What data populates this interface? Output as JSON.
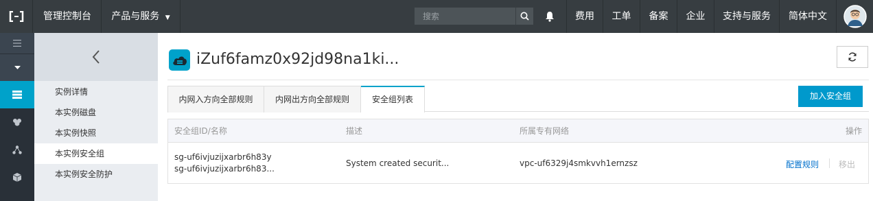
{
  "topbar": {
    "console_label": "管理控制台",
    "products_label": "产品与服务",
    "search_placeholder": "搜索",
    "nav": [
      "费用",
      "工单",
      "备案",
      "企业",
      "支持与服务",
      "简体中文"
    ]
  },
  "sidebar_icons": [
    "menu-icon",
    "chevron-down-icon",
    "server-list-icon",
    "cloud-icon",
    "network-icon",
    "cube-icon"
  ],
  "subnav": {
    "items": [
      "实例详情",
      "本实例磁盘",
      "本实例快照",
      "本实例安全组",
      "本实例安全防护"
    ],
    "active_index": 3
  },
  "page": {
    "title": "iZuf6famz0x92jd98na1ki..."
  },
  "tabs": [
    "内网入方向全部规则",
    "内网出方向全部规则",
    "安全组列表"
  ],
  "active_tab": 2,
  "actions": {
    "join_group": "加入安全组"
  },
  "table": {
    "headers": [
      "安全组ID/名称",
      "描述",
      "所属专有网络",
      "操作"
    ],
    "rows": [
      {
        "id": "sg-uf6ivjuzijxarbr6h83y",
        "name": "sg-uf6ivjuzijxarbr6h83...",
        "description": "System created securit...",
        "vpc": "vpc-uf6329j4smkvvh1ernzsz",
        "action_configure": "配置规则",
        "action_remove": "移出"
      }
    ]
  },
  "colors": {
    "topbar": "#373d41",
    "accent": "#00a2ca",
    "primary_button": "#0099cc",
    "link": "#0070cc"
  }
}
